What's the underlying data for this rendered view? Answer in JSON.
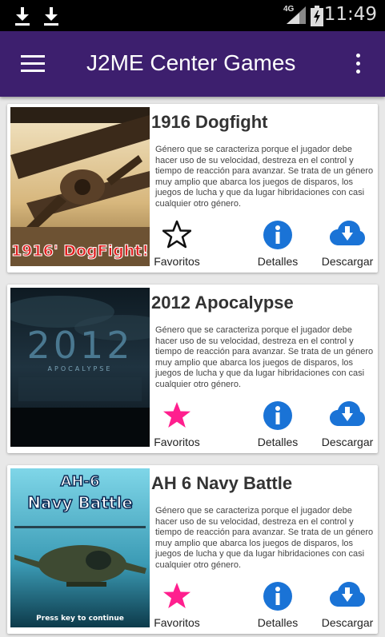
{
  "status_bar": {
    "time": "11:49",
    "network": "4G"
  },
  "app_bar": {
    "title": "J2ME Center Games"
  },
  "colors": {
    "app_bar": "#3d1f6e",
    "favorite_active": "#ff1f8e",
    "icon_blue": "#1a73d6"
  },
  "games": [
    {
      "title": "1916 Dogfight",
      "thumb_text": "1916' DogFight!",
      "description": "Género que se caracteriza porque el jugador debe hacer uso de su velocidad, destreza en el control y tiempo de reacción para avanzar. Se trata de un género muy amplio que abarca los juegos de disparos, los juegos de lucha y que da lugar hibridaciones con casi cualquier otro género.",
      "favorite_label": "Favoritos",
      "favorite_active": false,
      "details_label": "Detalles",
      "download_label": "Descargar"
    },
    {
      "title": "2012 Apocalypse",
      "thumb_text": "2012",
      "thumb_subtext": "APOCALYPSE",
      "description": "Género que se caracteriza porque el jugador debe hacer uso de su velocidad, destreza en el control y tiempo de reacción para avanzar. Se trata de un género muy amplio que abarca los juegos de disparos, los juegos de lucha y que da lugar hibridaciones con casi cualquier otro género.",
      "favorite_label": "Favoritos",
      "favorite_active": true,
      "details_label": "Detalles",
      "download_label": "Descargar"
    },
    {
      "title": "AH 6 Navy Battle",
      "thumb_text": "AH-6",
      "thumb_subtext": "Navy Battle",
      "thumb_footer": "Press key to continue",
      "description": "Género que se caracteriza porque el jugador debe hacer uso de su velocidad, destreza en el control y tiempo de reacción para avanzar. Se trata de un género muy amplio que abarca los juegos de disparos, los juegos de lucha y que da lugar hibridaciones con casi cualquier otro género.",
      "favorite_label": "Favoritos",
      "favorite_active": true,
      "details_label": "Detalles",
      "download_label": "Descargar"
    }
  ]
}
